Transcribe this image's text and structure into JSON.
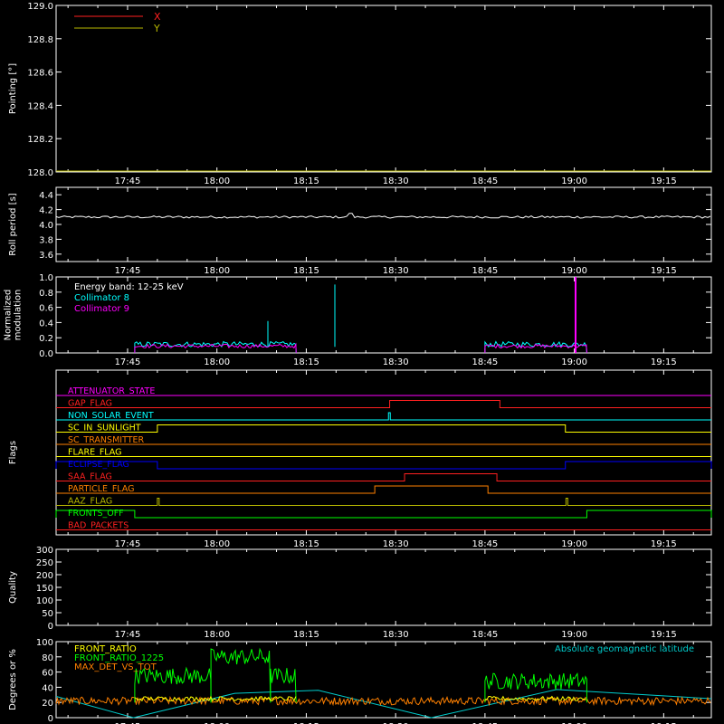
{
  "x_axis": {
    "ticks": [
      "17:45",
      "18:00",
      "18:15",
      "18:30",
      "18:45",
      "19:00",
      "19:15"
    ],
    "tick_minutes": [
      1065,
      1080,
      1095,
      1110,
      1125,
      1140,
      1155
    ],
    "range_minutes": [
      1053,
      1163
    ]
  },
  "colors": {
    "background": "#000000",
    "axes": "#ffffff",
    "x": "#ff2020",
    "y": "#b8b800",
    "cyan": "#00ffff",
    "magenta": "#ff00ff",
    "green": "#00ff00",
    "orange": "#ff8000",
    "yellow": "#ffff00"
  },
  "chart_data": [
    {
      "type": "line",
      "ylabel": "Pointing [°]",
      "ylim": [
        128.0,
        129.0
      ],
      "yticks": [
        "128.0",
        "128.2",
        "128.4",
        "128.6",
        "128.8",
        "129.0"
      ],
      "legend": [
        "X",
        "Y"
      ],
      "series": [
        {
          "name": "X",
          "color": "#ff2020",
          "values": []
        },
        {
          "name": "Y",
          "color": "#b8b800",
          "values": []
        }
      ]
    },
    {
      "type": "line",
      "ylabel": "Roll period [s]",
      "ylim": [
        3.5,
        4.5
      ],
      "yticks": [
        "3.6",
        "3.8",
        "4.0",
        "4.2",
        "4.4"
      ],
      "series": [
        {
          "color": "#ffffff",
          "x_min": [
            1053,
            1163
          ],
          "values_approx": [
            4.1,
            4.1
          ]
        }
      ]
    },
    {
      "type": "line",
      "ylabel": "Normalized modulation",
      "ylim": [
        0.0,
        1.0
      ],
      "yticks": [
        "0.0",
        "0.2",
        "0.4",
        "0.6",
        "0.8",
        "1.0"
      ],
      "annotations": [
        "Energy band: 12-25 keV"
      ],
      "legend": [
        "Collimator 8",
        "Collimator 9"
      ],
      "series": [
        {
          "name": "Collimator 8",
          "color": "#00ffff",
          "segments": [
            [
              1066.2,
              1093.3
            ],
            [
              1125.0,
              1142.1
            ]
          ],
          "baseline": 0.1
        },
        {
          "name": "Collimator 9",
          "color": "#ff00ff",
          "segments": [
            [
              1066.2,
              1093.3
            ],
            [
              1125.0,
              1142.1
            ]
          ],
          "baseline": 0.08
        }
      ]
    },
    {
      "type": "line",
      "ylabel": "Flags",
      "flags": [
        {
          "label": "ATTENUATOR_STATE",
          "color": "#ff00ff",
          "on": []
        },
        {
          "label": "GAP_FLAG",
          "color": "#ff2020",
          "on": [
            [
              1109,
              1127.5
            ]
          ]
        },
        {
          "label": "NON_SOLAR_EVENT",
          "color": "#00ffff",
          "on": [
            [
              1108.8,
              1109.1
            ]
          ]
        },
        {
          "label": "SC_IN_SUNLIGHT",
          "color": "#ffff00",
          "on": [
            [
              1070,
              1138.5
            ]
          ]
        },
        {
          "label": "SC_TRANSMITTER",
          "color": "#ff8000",
          "on": []
        },
        {
          "label": "FLARE_FLAG",
          "color": "#ffff00",
          "on": []
        },
        {
          "label": "ECLIPSE_FLAG",
          "color": "#0000ff",
          "on": [
            [
              1053,
              1070
            ],
            [
              1138.5,
              1163
            ]
          ]
        },
        {
          "label": "SAA_FLAG",
          "color": "#ff2020",
          "on": [
            [
              1111.5,
              1127
            ]
          ]
        },
        {
          "label": "PARTICLE_FLAG",
          "color": "#ff8000",
          "on": [
            [
              1106.5,
              1125.5
            ]
          ]
        },
        {
          "label": "AAZ_FLAG",
          "color": "#b8b800",
          "on": [
            [
              1070,
              1070.3
            ],
            [
              1138.6,
              1138.9
            ]
          ]
        },
        {
          "label": "FRONTS_OFF",
          "color": "#00ff00",
          "on": [
            [
              1053,
              1066.2
            ],
            [
              1142.1,
              1163
            ]
          ]
        },
        {
          "label": "BAD_PACKETS",
          "color": "#ff2020",
          "on": []
        }
      ]
    },
    {
      "type": "line",
      "ylabel": "Quality",
      "ylim": [
        0,
        300
      ],
      "yticks": [
        "0",
        "50",
        "100",
        "150",
        "200",
        "250",
        "300"
      ],
      "series": [
        {
          "color": "#ffffff",
          "values_approx": [
            300,
            300
          ]
        }
      ]
    },
    {
      "type": "line",
      "ylabel": "Degrees or %",
      "ylim": [
        0,
        100
      ],
      "yticks": [
        "0",
        "20",
        "40",
        "60",
        "80",
        "100"
      ],
      "legend": [
        "FRONT_RATIO",
        "FRONT_RATIO_1225",
        "MAX_DET_VS_TOT",
        "Absolute geomagnetic latitude"
      ],
      "series": [
        {
          "name": "FRONT_RATIO",
          "color": "#ffff00",
          "segments": [
            [
              1066.2,
              1093.3
            ],
            [
              1125.0,
              1142.1
            ]
          ],
          "level_approx": 25
        },
        {
          "name": "FRONT_RATIO_1225",
          "color": "#00ff00",
          "segments": [
            [
              1066.2,
              1079.0
            ],
            [
              1079.0,
              1089.0
            ],
            [
              1089.0,
              1093.3
            ],
            [
              1125.0,
              1142.1
            ]
          ],
          "levels_approx": [
            55,
            80,
            55,
            48
          ]
        },
        {
          "name": "MAX_DET_VS_TOT",
          "color": "#ff8000",
          "level_approx": 22
        },
        {
          "name": "Absolute geomagnetic latitude",
          "color": "#00cccc",
          "x": [
            1053,
            1066,
            1083,
            1097,
            1116,
            1137,
            1163
          ],
          "values": [
            28,
            0,
            32,
            36,
            0,
            37,
            25
          ]
        }
      ]
    }
  ]
}
